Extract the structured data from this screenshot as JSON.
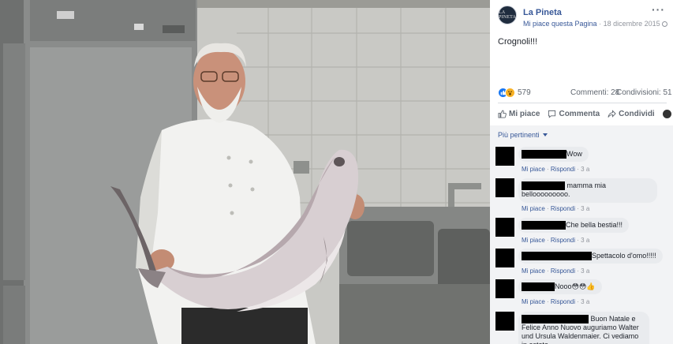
{
  "post": {
    "page_name": "La Pineta",
    "avatar_text": "LA PINETA",
    "like_page": "Mi piace questa Pagina",
    "separator": " · ",
    "date": "18 dicembre 2015",
    "more_label": "···",
    "text": "Crognoli!!!"
  },
  "stats": {
    "reactions": "579",
    "comments": "Commenti: 28",
    "shares": "Condivisioni: 51"
  },
  "actions": {
    "like": "Mi piace",
    "comment": "Commenta",
    "share": "Condividi"
  },
  "sort": {
    "label": "Più pertinenti"
  },
  "comments": [
    {
      "text": "Wow",
      "like": "Mi piace",
      "reply": "Rispondi",
      "time": "3 a"
    },
    {
      "text": "mamma mia bellooooooooo.",
      "like": "Mi piace",
      "reply": "Rispondi",
      "time": "3 a"
    },
    {
      "text": "Che bella bestia!!!",
      "like": "Mi piace",
      "reply": "Rispondi",
      "time": "3 a"
    },
    {
      "text": "Spettacolo d'omo!!!!!",
      "like": "Mi piace",
      "reply": "Rispondi",
      "time": "3 a"
    },
    {
      "text": "Nooo😳😳👍",
      "like": "Mi piace",
      "reply": "Rispondi",
      "time": "3 a"
    },
    {
      "text": "Buon Natale e Felice Anno Nuovo auguriamo Walter und Ursula Waldenmaier. Ci vediamo in estate"
    }
  ],
  "colors": {
    "link": "#385898",
    "muted": "#90949c",
    "bubble": "#e9ebee"
  }
}
